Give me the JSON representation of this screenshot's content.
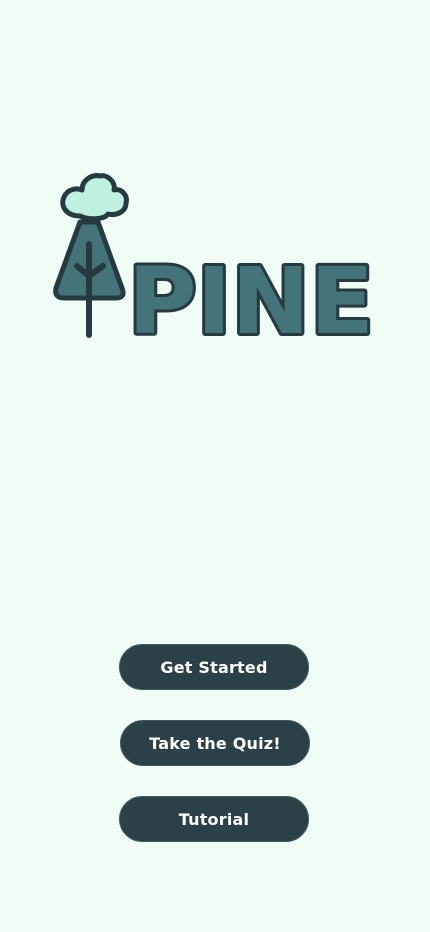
{
  "app": {
    "logo_text": "PINE",
    "colors": {
      "background": "#f0fdf7",
      "button_bg": "#2c4048",
      "button_text": "#ffffff",
      "logo_fill": "#44737a",
      "logo_outline": "#263b40",
      "crown_fill": "#bff0e2"
    }
  },
  "menu": {
    "get_started_label": "Get Started",
    "quiz_label": "Take the Quiz!",
    "tutorial_label": "Tutorial"
  },
  "icons": {
    "logo_tree": "tree-icon"
  }
}
